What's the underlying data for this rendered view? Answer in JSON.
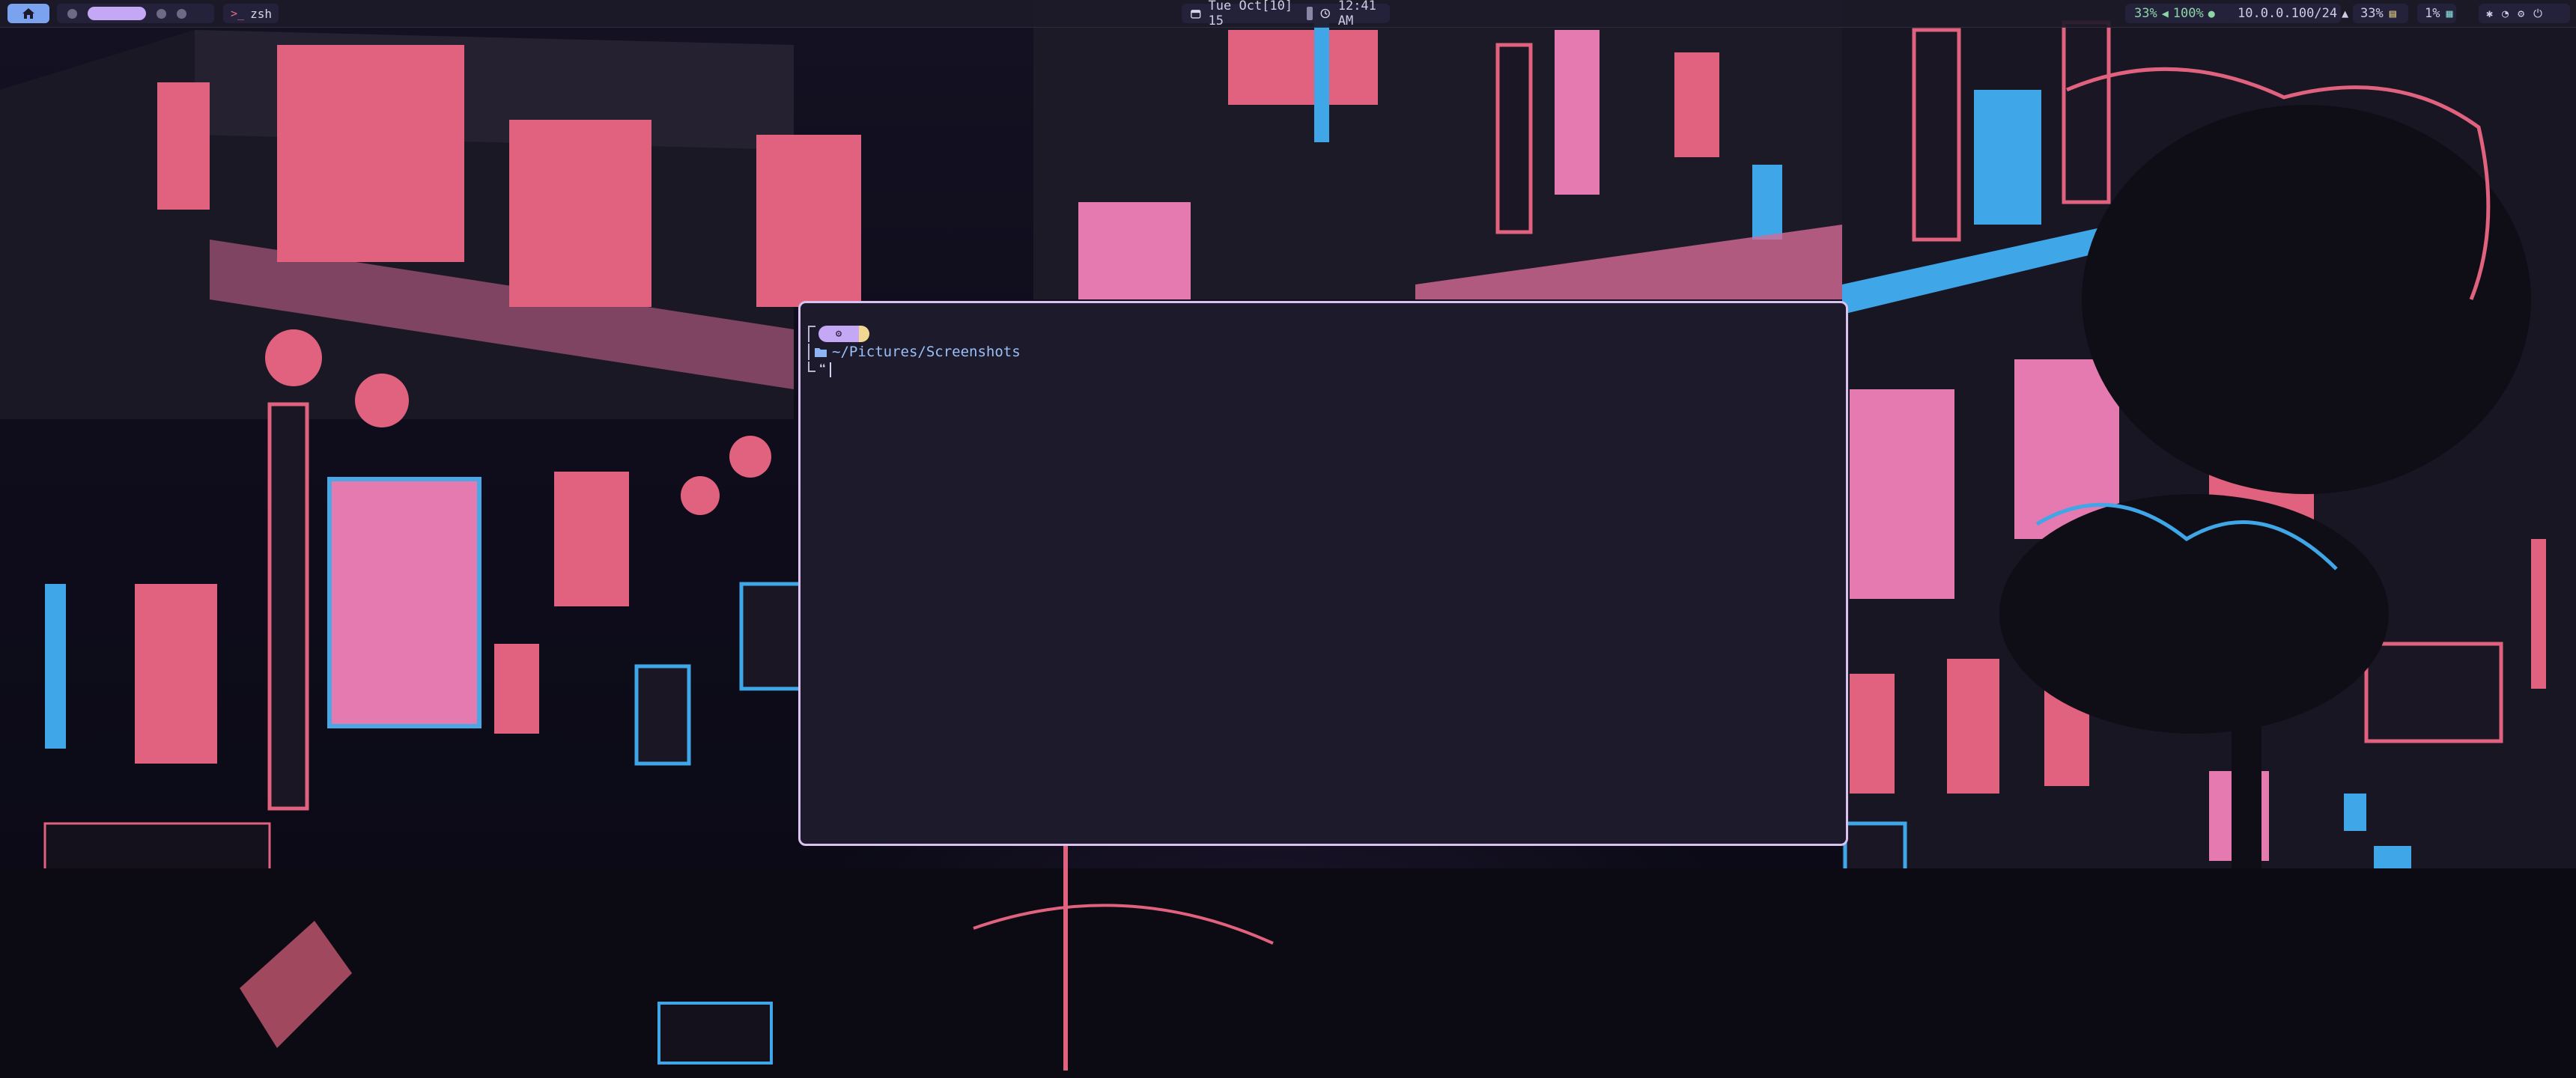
{
  "colors": {
    "accent": "#c4a7f5",
    "home": "#7aa2ee",
    "window_border": "#d9c2f0",
    "terminal_bg": "#1c1a2b",
    "neon_pink": "#e05a80",
    "neon_blue": "#3fa6e8"
  },
  "topbar": {
    "home_icon": "home-icon",
    "workspaces": [
      "1",
      "2",
      "3",
      "4"
    ],
    "active_workspace_index": 1,
    "window_title": "zsh",
    "date": "Tue Oct[10] 15",
    "time": "12:41 AM",
    "status": {
      "volume": "33%",
      "mic": "100%",
      "network": "10.0.0.100/24",
      "memory": "33%",
      "cpu": "1%"
    }
  },
  "terminal": {
    "os_icon": "gear-icon",
    "path": "~/Pictures/Screenshots",
    "input_prompt": "❝"
  }
}
